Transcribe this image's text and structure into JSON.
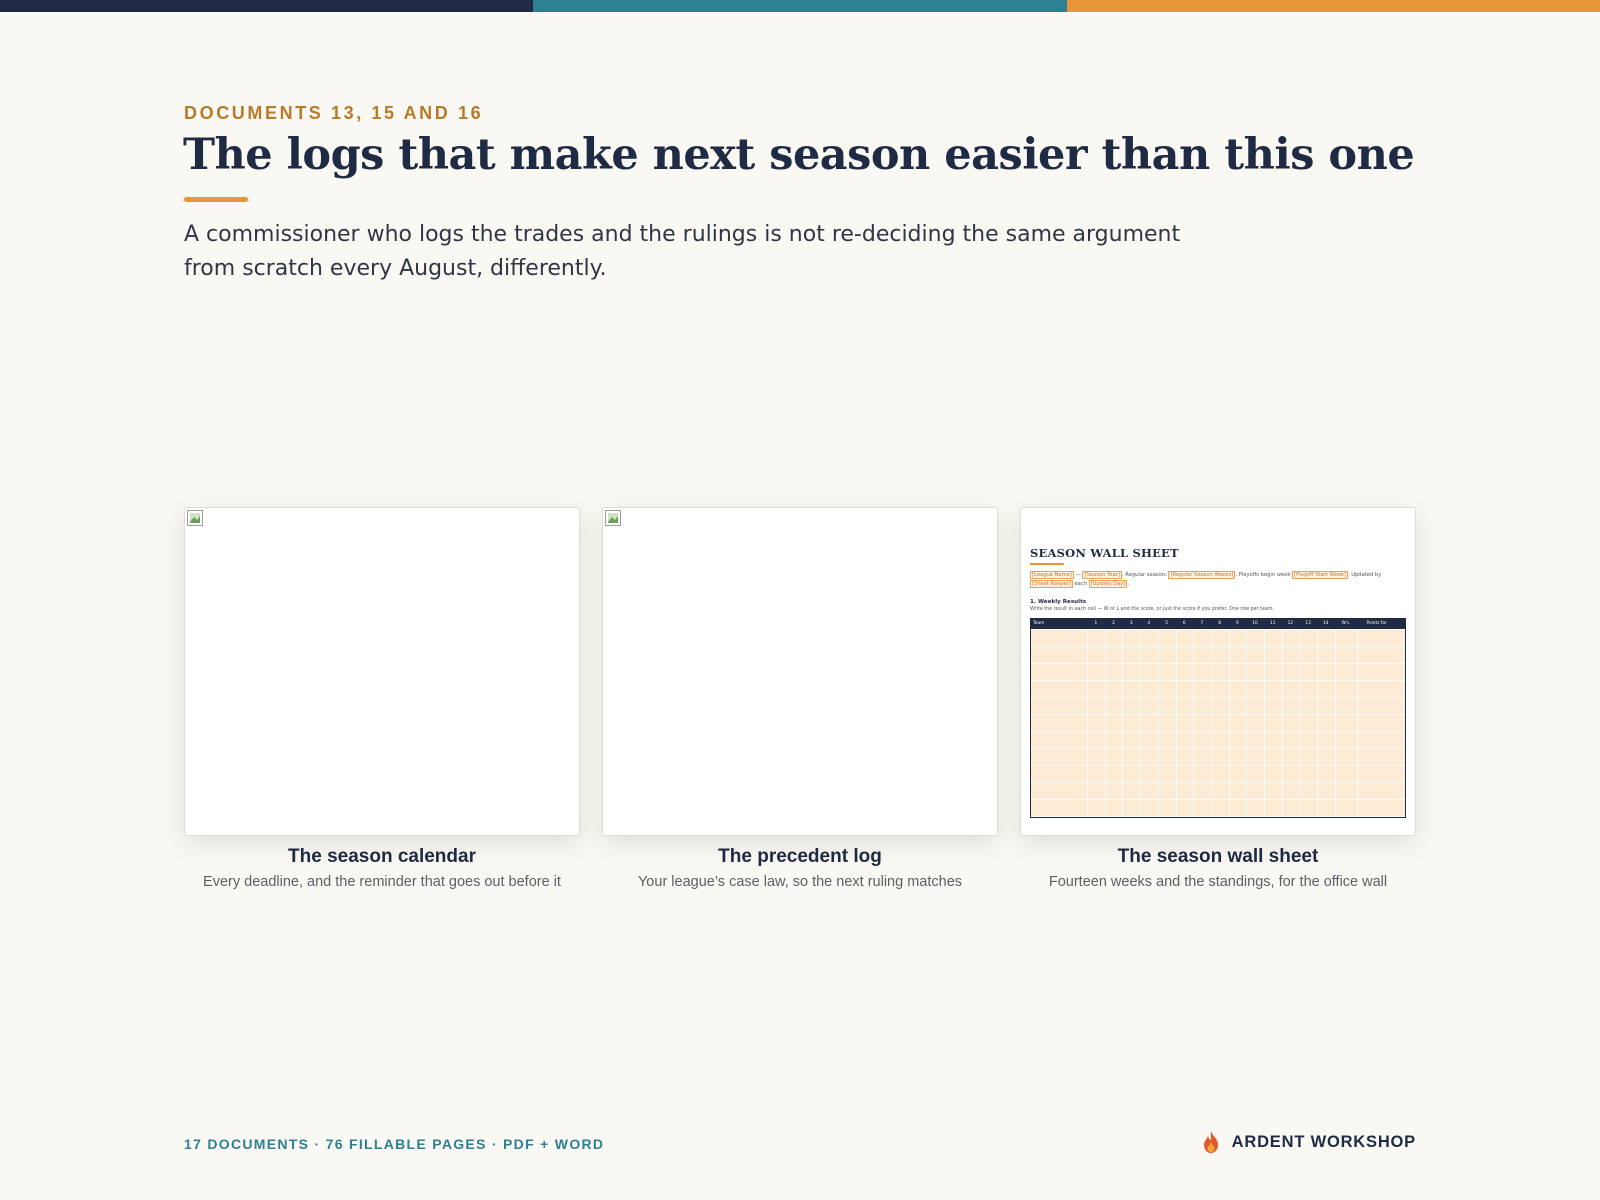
{
  "colors": {
    "navy": "#1f2a44",
    "teal": "#2f7f93",
    "orange": "#e8963a",
    "gold": "#b7792a"
  },
  "header": {
    "eyebrow": "DOCUMENTS 13, 15 AND 16",
    "title": "The logs that make next season easier than this one",
    "subtitle": "A commissioner who logs the trades and the rulings is not re-deciding the same argument from scratch every August, differently."
  },
  "cards": [
    {
      "title": "The season calendar",
      "subtitle": "Every deadline, and the reminder that goes out before it"
    },
    {
      "title": "The precedent log",
      "subtitle": "Your league’s case law, so the next ruling matches"
    },
    {
      "title": "The season wall sheet",
      "subtitle": "Fourteen weeks and the standings, for the office wall"
    }
  ],
  "wall_sheet": {
    "title": "SEASON WALL SHEET",
    "placeholders": {
      "league_name": "[League Name]",
      "season_year": "[Season Year]",
      "regular_season_weeks": "[Regular Season Weeks]",
      "playoff_start_week": "[Playoff Start Week]",
      "sheet_keeper": "[Sheet Keeper]",
      "update_day": "[Update Day]"
    },
    "meta_text": {
      "dash": " — ",
      "regular_season": ". Regular season: ",
      "playoffs": ". Playoffs begin week ",
      "updated_by": ". Updated by ",
      "each": " each ",
      "end": "."
    },
    "section": "1. Weekly Results",
    "instruction": "Write the result in each cell — W or L and the score, or just the score if you prefer. One row per team.",
    "columns": [
      "Team",
      "1",
      "2",
      "3",
      "4",
      "5",
      "6",
      "7",
      "8",
      "9",
      "10",
      "11",
      "12",
      "13",
      "14",
      "W-L",
      "Points for"
    ]
  },
  "footer": {
    "left": "17 DOCUMENTS · 76 FILLABLE PAGES · PDF + WORD",
    "brand": "ARDENT WORKSHOP",
    "brand_icon": "flame-icon"
  }
}
